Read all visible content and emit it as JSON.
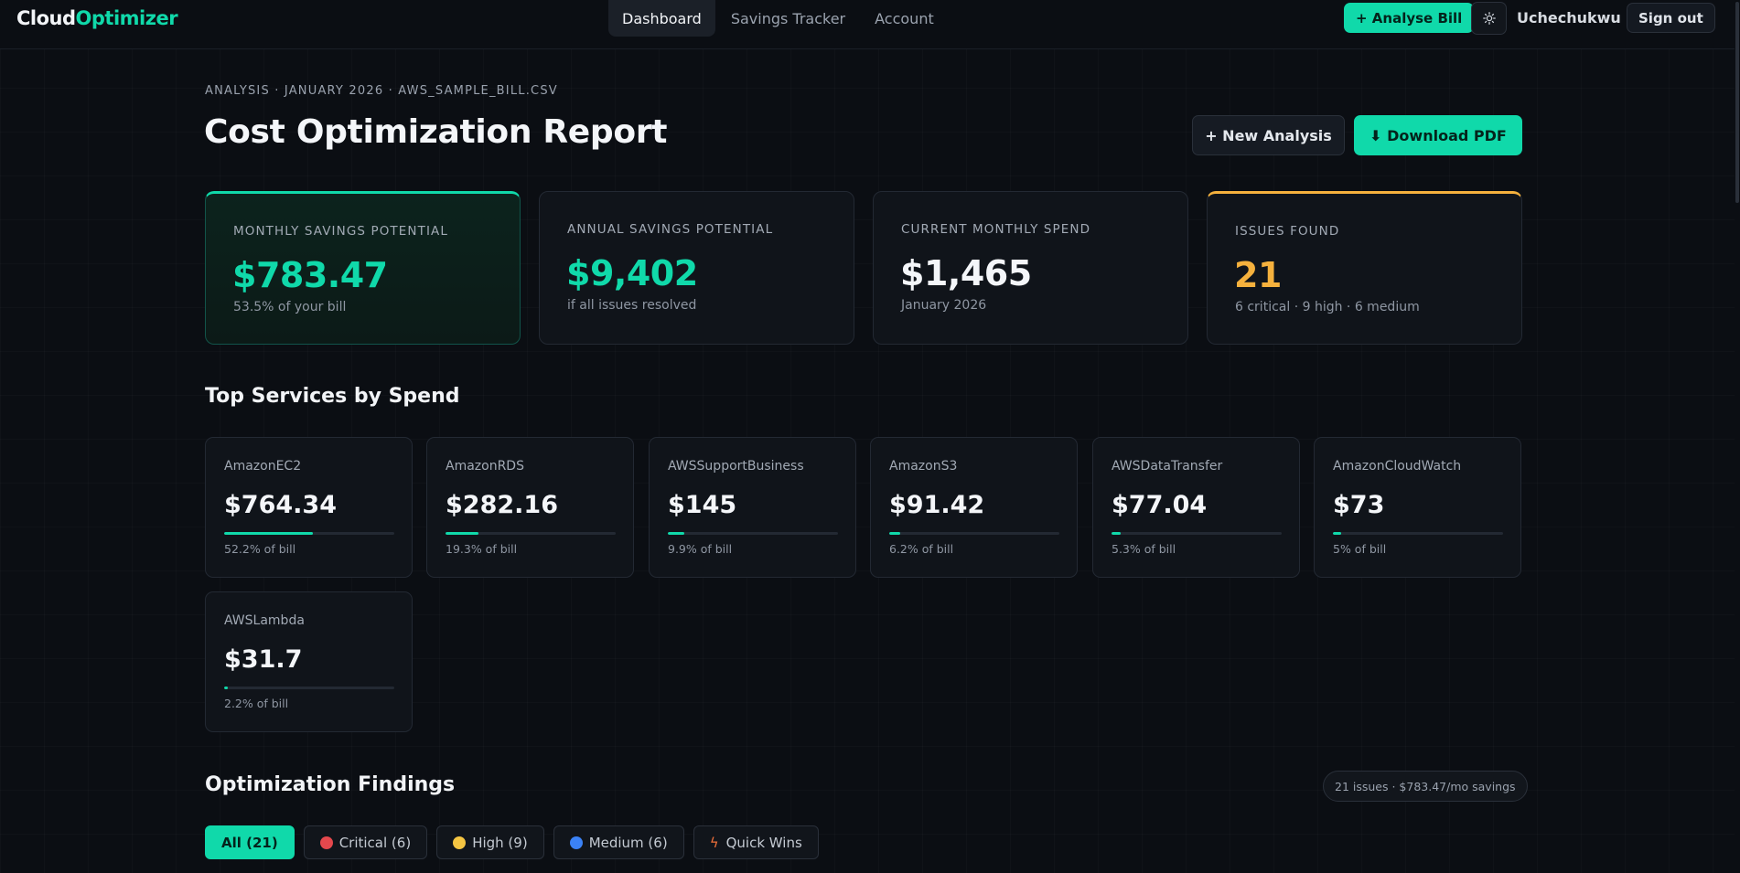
{
  "nav": {
    "logo_part1": "Cloud",
    "logo_part2": "Optimizer",
    "tabs": [
      {
        "label": "Dashboard"
      },
      {
        "label": "Savings Tracker"
      },
      {
        "label": "Account"
      }
    ],
    "analyse_label": "+ Analyse Bill",
    "theme_icon": "sun-icon",
    "username": "Uchechukwu",
    "signout_label": "Sign out"
  },
  "header": {
    "breadcrumb": "ANALYSIS · JANUARY 2026 · AWS_SAMPLE_BILL.CSV",
    "title": "Cost Optimization Report",
    "new_analysis_label": "+ New Analysis",
    "download_label": "⬇ Download PDF"
  },
  "kpis": [
    {
      "label": "MONTHLY SAVINGS POTENTIAL",
      "value": "$783.47",
      "sub": "53.5% of your bill"
    },
    {
      "label": "ANNUAL SAVINGS POTENTIAL",
      "value": "$9,402",
      "sub": "if all issues resolved"
    },
    {
      "label": "CURRENT MONTHLY SPEND",
      "value": "$1,465",
      "sub": "January 2026"
    },
    {
      "label": "ISSUES FOUND",
      "value": "21",
      "sub": "6 critical · 9 high · 6 medium"
    }
  ],
  "services_section": {
    "title": "Top Services by Spend",
    "items": [
      {
        "name": "AmazonEC2",
        "amount": "$764.34",
        "pct": "52.2% of bill",
        "share": 52.2
      },
      {
        "name": "AmazonRDS",
        "amount": "$282.16",
        "pct": "19.3% of bill",
        "share": 19.3
      },
      {
        "name": "AWSSupportBusiness",
        "amount": "$145",
        "pct": "9.9% of bill",
        "share": 9.9
      },
      {
        "name": "AmazonS3",
        "amount": "$91.42",
        "pct": "6.2% of bill",
        "share": 6.2
      },
      {
        "name": "AWSDataTransfer",
        "amount": "$77.04",
        "pct": "5.3% of bill",
        "share": 5.3
      },
      {
        "name": "AmazonCloudWatch",
        "amount": "$73",
        "pct": "5% of bill",
        "share": 5
      },
      {
        "name": "AWSLambda",
        "amount": "$31.7",
        "pct": "2.2% of bill",
        "share": 2.2
      }
    ]
  },
  "findings": {
    "title": "Optimization Findings",
    "summary": "21 issues · $783.47/mo savings",
    "filters": [
      {
        "label": "All (21)"
      },
      {
        "label": "Critical (6)",
        "color": "#e5484d"
      },
      {
        "label": "High (9)",
        "color": "#f5c542"
      },
      {
        "label": "Medium (6)",
        "color": "#3b82f6"
      },
      {
        "label": "Quick Wins",
        "icon": "lightning-icon"
      }
    ]
  },
  "colors": {
    "accent": "#10d9aa",
    "amber": "#f5b13d",
    "background": "#0b0e13"
  }
}
